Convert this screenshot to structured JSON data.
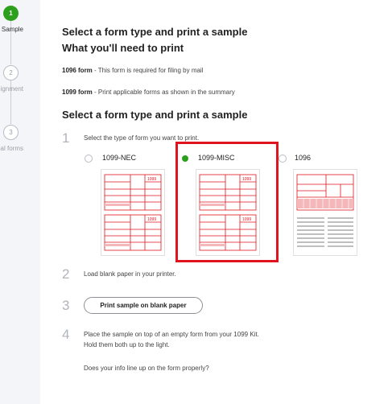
{
  "sidebar": {
    "steps": [
      {
        "number": "1",
        "label": "Sample"
      },
      {
        "number": "2",
        "label": "Alignment"
      },
      {
        "number": "3",
        "label": "Final forms"
      }
    ]
  },
  "main": {
    "title": "Select a form type and print a sample",
    "subtitle": "What you'll need to print",
    "requirements": [
      {
        "name": "1096 form",
        "desc": "- This form is required for filing by mail"
      },
      {
        "name": "1099 form",
        "desc": "- Print applicable forms as shown in the summary"
      }
    ],
    "section_title": "Select a form type and print a sample",
    "steps": [
      {
        "number": "1",
        "text": "Select the type of form you want to print."
      },
      {
        "number": "2",
        "text": "Load blank paper in your printer."
      },
      {
        "number": "3",
        "button": "Print sample on blank paper"
      },
      {
        "number": "4",
        "line1": "Place the sample on top of an empty form from your 1099 Kit.",
        "line2": "Hold them both up to the light.",
        "question": "Does your info line up on the form properly?"
      }
    ],
    "form_options": [
      {
        "label": "1099-NEC",
        "selected": false
      },
      {
        "label": "1099-MISC",
        "selected": true
      },
      {
        "label": "1096",
        "selected": false
      }
    ],
    "form_thumb_text": "1099"
  },
  "colors": {
    "accent_green": "#2ca01c",
    "form_red": "#e0141e",
    "highlight_red": "#e0141e"
  }
}
